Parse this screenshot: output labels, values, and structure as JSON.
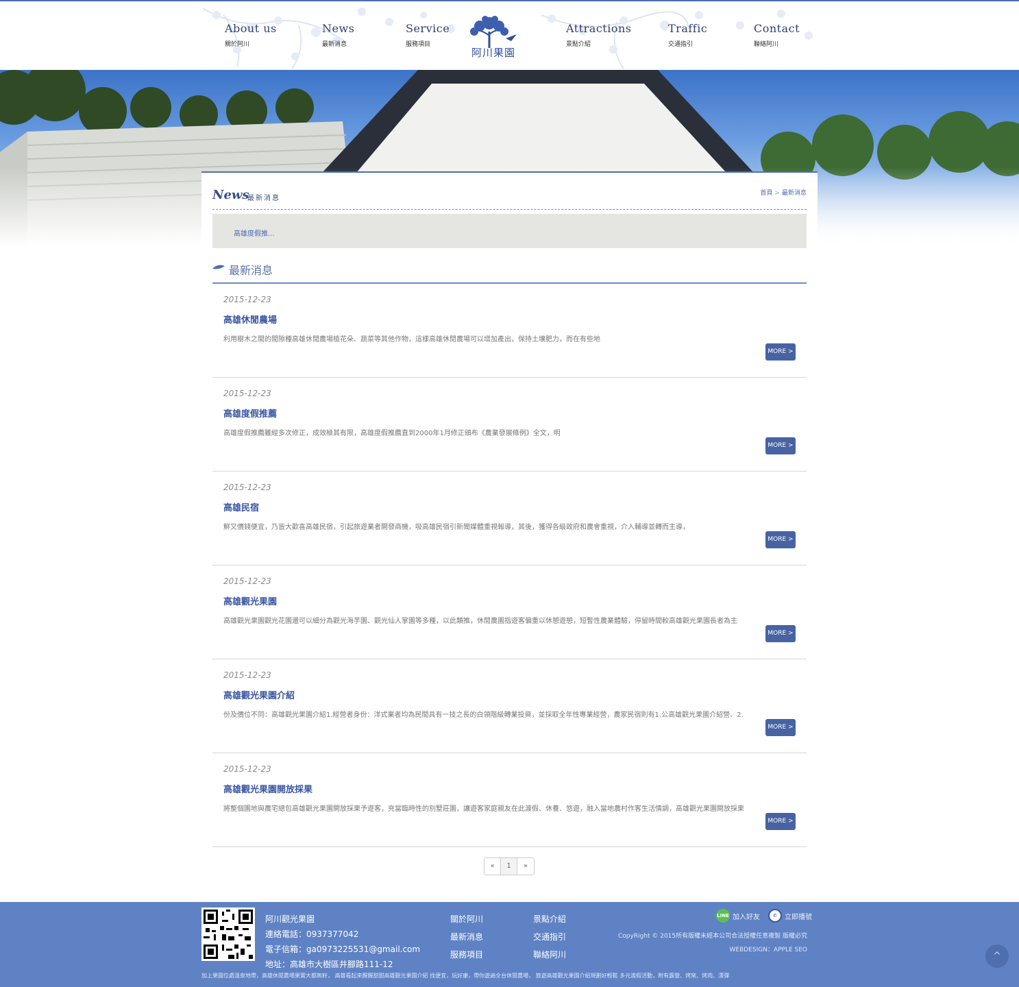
{
  "nav": {
    "items": [
      {
        "en": "About us",
        "zh": "關於阿川"
      },
      {
        "en": "News",
        "zh": "最新消息"
      },
      {
        "en": "Service",
        "zh": "服務項目"
      },
      {
        "en": "Attractions",
        "zh": "景點介紹"
      },
      {
        "en": "Traffic",
        "zh": "交通指引"
      },
      {
        "en": "Contact",
        "zh": "聯絡阿川"
      }
    ],
    "logo_text": "阿川果園"
  },
  "page": {
    "title_en": "News",
    "title_zh": "最新消息",
    "breadcrumb": {
      "home": "首頁",
      "sep": ">",
      "current": "最新消息"
    },
    "subnav": "高雄度假推...",
    "section_title": "最新消息"
  },
  "news": [
    {
      "date": "2015-12-23",
      "title": "高雄休閒農場",
      "desc": "利用樹木之間的間隙種高雄休閒農場植花朵、蔬菜等其他作物，這樣高雄休閒農場可以增加產出，保持土壤肥力，而在有些地",
      "more": "MORE >"
    },
    {
      "date": "2015-12-23",
      "title": "高雄度假推薦",
      "desc": "高雄度假推薦雖經多次修正，成效極其有限，高雄度假推薦直到2000年1月修正頒布《農業發展條例》全文，明",
      "more": "MORE >"
    },
    {
      "date": "2015-12-23",
      "title": "高雄民宿",
      "desc": "鮮又價錢便宜，乃皆大歡喜高雄民宿，引起旅遊業者開發商機，吸高雄民宿引新聞媒體重視報導，其後，獲得各級政府和農會重視，介入輔導並轉而主導，",
      "more": "MORE >"
    },
    {
      "date": "2015-12-23",
      "title": "高雄觀光果園",
      "desc": "高雄觀光果園觀光花園還可以細分為觀光海芋園、觀光仙人掌園等多種，以此類推，休閒農園指遊客偏重以休憩遊憩，短暫性農業體驗，停留時間較高雄觀光果園長者為主",
      "more": "MORE >"
    },
    {
      "date": "2015-12-23",
      "title": "高雄觀光果園介紹",
      "desc": "份及價位不同：高雄觀光果園介紹1.經營者身份：洋式業者均為民間具有一技之長的白領階級轉業投資，並採取全年性專業經營，農家民宿則有1.公高雄觀光果園介紹營、2.",
      "more": "MORE >"
    },
    {
      "date": "2015-12-23",
      "title": "高雄觀光果園開放採果",
      "desc": "將整個園地與農宅總包高雄觀光果園開放採果予遊客，充當臨時性的別墅莊園，讓遊客家庭親友在此渡假、休養、悠遊，融入當地農村作客生活情調，高雄觀光果園開放採果",
      "more": "MORE >"
    }
  ],
  "pager": {
    "prev": "«",
    "current": "1",
    "next": "»"
  },
  "footer": {
    "name": "阿川觀光果園",
    "phone": "連絡電話：0937377042",
    "email": "電子信箱：ga0973225531@gmail.com",
    "address": "地址：高雄市大樹區井腳路111-12",
    "links_col1": [
      "關於阿川",
      "最新消息",
      "服務項目"
    ],
    "links_col2": [
      "景點介紹",
      "交通指引",
      "聯絡阿川"
    ],
    "line_label": "加入好友",
    "call_label": "立即播號",
    "line_icon": "LINE",
    "copyright": "CopyRight © 2015所有版權未經本公司合法授權任意複製 版權必究",
    "webdesign": "WEBDESIGN：APPLE SEO",
    "bottom_text": "加上果園位處溫泉地帶，高雄休閒農場果實大都無籽， 高雄看起來醒醒甜甜高雄觀光果園介紹 找便宜，玩好康，帶你遊遍全台休閒農場， 旅遊高雄觀光果園介紹規劃好輕鬆 多元渡假活動，附有露營、烤窯、烤肉、漂彈",
    "to_top": "^"
  },
  "colors": {
    "accent": "#4e6fb0",
    "button": "#4763a2",
    "footer": "#5f82c4",
    "title": "#3a56a0"
  }
}
